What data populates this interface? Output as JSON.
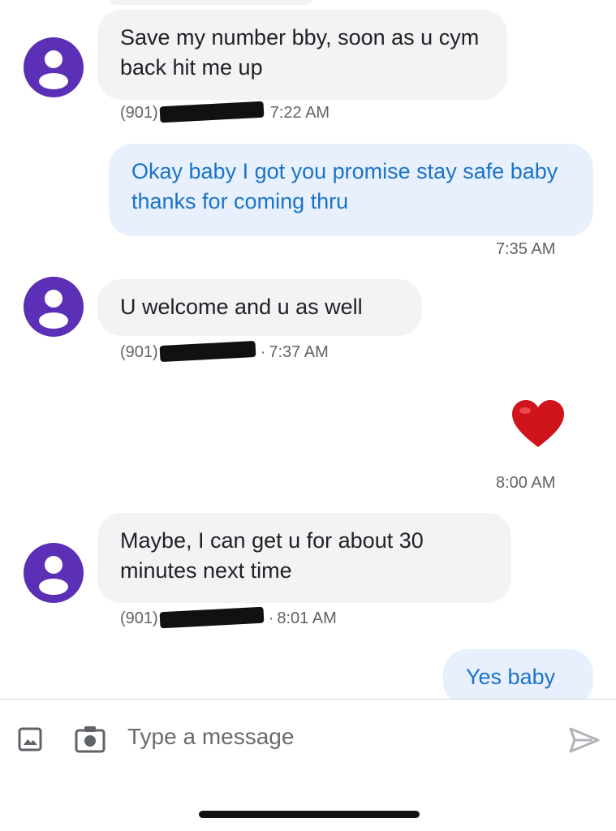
{
  "messages": [
    {
      "direction": "in",
      "text": "Save my number bby, soon as u cym back hit me up",
      "phone_prefix": "(901)",
      "time": "7:22 AM"
    },
    {
      "direction": "out",
      "text": "Okay baby I got you promise stay safe baby thanks for coming thru",
      "time": "7:35 AM"
    },
    {
      "direction": "in",
      "text": "U welcome and u as well",
      "phone_prefix": "(901)",
      "time": "7:37 AM"
    },
    {
      "direction": "out",
      "emoji": "heart",
      "time": "8:00 AM"
    },
    {
      "direction": "in",
      "text": "Maybe, I can get u for about 30 minutes next time",
      "phone_prefix": "(901)",
      "time": "8:01 AM"
    },
    {
      "direction": "out",
      "text": "Yes baby"
    }
  ],
  "composer": {
    "placeholder": "Type a message",
    "icons": [
      "gallery-icon",
      "camera-icon",
      "send-icon"
    ]
  },
  "colors": {
    "avatar": "#5b2fb6",
    "incoming_bubble": "#f1f3f4",
    "outgoing_bubble": "#e8f0fe",
    "outgoing_text": "#1a73c8",
    "heart": "#d0141c"
  }
}
